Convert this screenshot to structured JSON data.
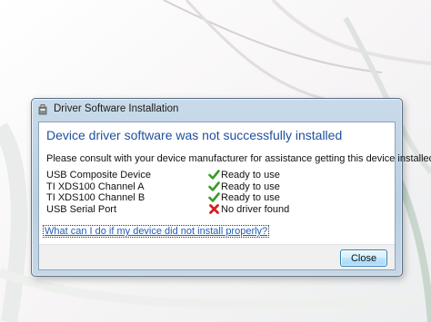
{
  "dialog": {
    "title": "Driver Software Installation",
    "heading": "Device driver software was not successfully installed",
    "message": "Please consult with your device manufacturer for assistance getting this device installed.",
    "devices": [
      {
        "name": "USB Composite Device",
        "status": "Ready to use",
        "status_icon": "check-icon"
      },
      {
        "name": "TI XDS100 Channel A",
        "status": "Ready to use",
        "status_icon": "check-icon"
      },
      {
        "name": "TI XDS100 Channel B",
        "status": "Ready to use",
        "status_icon": "check-icon"
      },
      {
        "name": "USB Serial Port",
        "status": "No driver found",
        "status_icon": "error-x-icon"
      }
    ],
    "help_link": "What can I do if my device did not install properly?",
    "close_label": "Close"
  },
  "colors": {
    "heading": "#1f4f9d",
    "link": "#1f5fb8",
    "success": "#3a9a2a",
    "error": "#d42020"
  }
}
